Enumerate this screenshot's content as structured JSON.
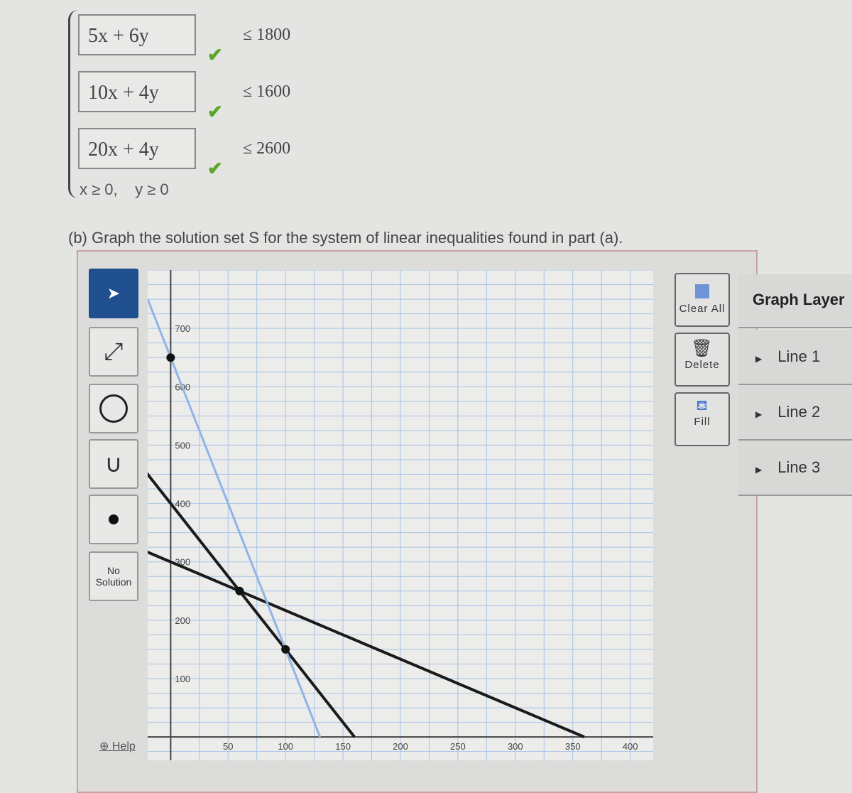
{
  "system": {
    "rows": [
      {
        "lhs": "5x + 6y",
        "rhs": "≤ 1800"
      },
      {
        "lhs": "10x + 4y",
        "rhs": "≤ 1600"
      },
      {
        "lhs": "20x + 4y",
        "rhs": "≤ 2600"
      }
    ],
    "check": "✔",
    "nonneg": "x ≥ 0,    y ≥ 0"
  },
  "question": "(b) Graph the solution set S for the system of linear inequalities found in part (a).",
  "tools": {
    "no_solution": "No\nSolution",
    "help": "Help"
  },
  "actions": {
    "clear_all": "Clear All",
    "delete": "Delete",
    "fill": "Fill"
  },
  "layers": {
    "title": "Graph Layer",
    "items": [
      "Line 1",
      "Line 2",
      "Line 3"
    ]
  },
  "chart_data": {
    "type": "line",
    "x_ticks": [
      50,
      100,
      150,
      200,
      250,
      300,
      350,
      400
    ],
    "y_ticks": [
      100,
      200,
      300,
      400,
      500,
      600,
      700
    ],
    "xlim": [
      -20,
      420
    ],
    "ylim": [
      -40,
      800
    ],
    "grid": true,
    "series": [
      {
        "equation": "5x + 6y = 1800",
        "points": [
          [
            -30,
            325
          ],
          [
            360,
            0
          ]
        ],
        "color": "#1a1a1a"
      },
      {
        "equation": "10x + 4y = 1600",
        "points": [
          [
            -40,
            500
          ],
          [
            160,
            0
          ]
        ],
        "color": "#1a1a1a"
      },
      {
        "equation": "20x + 4y = 2600",
        "points": [
          [
            -20,
            750
          ],
          [
            130,
            0
          ]
        ],
        "color": "#8fb4e6"
      }
    ],
    "marked_points": [
      [
        0,
        650
      ],
      [
        60,
        250
      ],
      [
        100,
        150
      ]
    ]
  }
}
